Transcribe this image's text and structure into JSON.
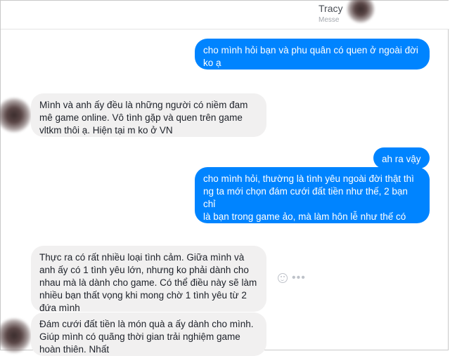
{
  "header": {
    "contact_name": "Tracy",
    "contact_sub": "Messe"
  },
  "messages": [
    {
      "side": "out",
      "text": "cho mình hỏi bạn và phu quân có quen ở ngoài đời\nko ạ"
    },
    {
      "side": "in",
      "text": "Mình và anh ấy đều là những người có niềm đam\nmê game online. Vô tình gặp và quen trên game\nvltkm thôi ạ. Hiện tại m ko ở VN"
    },
    {
      "side": "out",
      "text": "ah ra vậy"
    },
    {
      "side": "out",
      "text": "cho mình hỏi, thường là tình yêu ngoài đời thật thì\nng ta mới chọn đám cưới đất tiền như thế, 2 bạn chỉ\nlà bạn trong game ảo, mà làm hôn lễ như thế có\nthấy phí ko ạ ^^"
    },
    {
      "side": "in",
      "text": "Thực ra có rất nhiều loại tình cảm. Giữa mình và\nanh ấy có 1 tình yêu lớn, nhưng ko phải dành cho\nnhau mà là dành cho game. Có thể điều này sẽ làm\nnhiều bạn thất vọng khi mong chờ 1 tình yêu từ 2\nđứa mình"
    },
    {
      "side": "in",
      "text": "Đám cưới đất tiền là món quà a ấy dành cho mình.\nGiúp mình có quãng thời gian trải nghiệm game\nhoàn thiên. Nhất"
    }
  ],
  "icons": {
    "react": "smiley-icon",
    "more": "more-icon"
  },
  "colors": {
    "outgoing_bubble": "#0084ff",
    "incoming_bubble": "#f1f0f0"
  }
}
